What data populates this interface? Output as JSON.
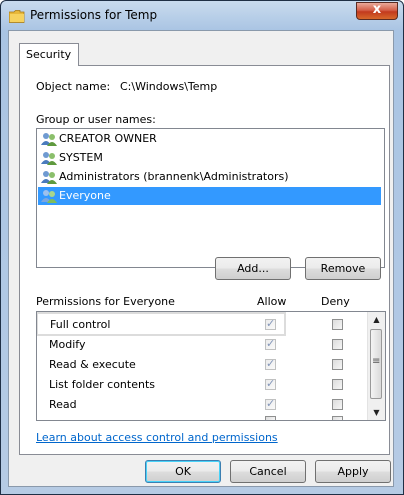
{
  "window": {
    "title": "Permissions for Temp",
    "close_label": "x"
  },
  "tabs": [
    "Security"
  ],
  "object": {
    "label": "Object name:",
    "value": "C:\\Windows\\Temp"
  },
  "users": {
    "heading": "Group or user names:",
    "items": [
      {
        "label": "CREATOR OWNER",
        "selected": false
      },
      {
        "label": "SYSTEM",
        "selected": false
      },
      {
        "label": "Administrators (brannenk\\Administrators)",
        "selected": false
      },
      {
        "label": "Everyone",
        "selected": true
      }
    ],
    "add_label": "Add...",
    "remove_label": "Remove"
  },
  "permissions": {
    "heading": "Permissions for Everyone",
    "allow_header": "Allow",
    "deny_header": "Deny",
    "rows": [
      {
        "name": "Full control",
        "allow": true,
        "deny": false
      },
      {
        "name": "Modify",
        "allow": true,
        "deny": false
      },
      {
        "name": "Read & execute",
        "allow": true,
        "deny": false
      },
      {
        "name": "List folder contents",
        "allow": true,
        "deny": false
      },
      {
        "name": "Read",
        "allow": true,
        "deny": false
      }
    ]
  },
  "link_text": "Learn about access control and permissions",
  "footer": {
    "ok": "OK",
    "cancel": "Cancel",
    "apply": "Apply"
  },
  "colors": {
    "selection": "#3399ff",
    "link": "#0066cc"
  }
}
